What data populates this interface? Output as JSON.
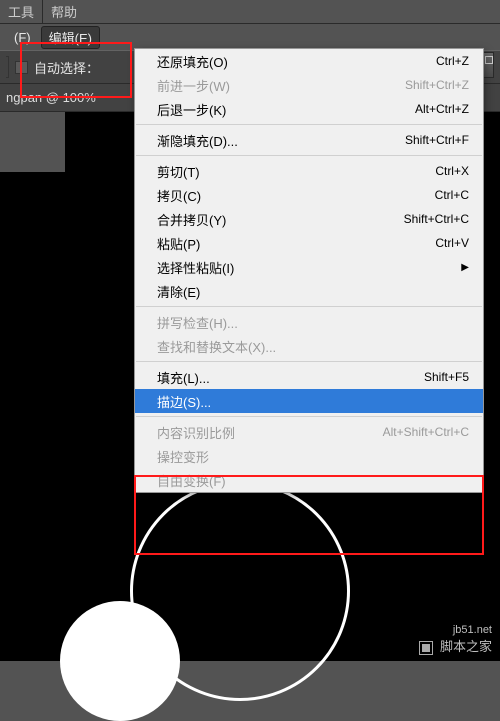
{
  "topbar": {
    "tabs": [
      "工具",
      "帮助"
    ]
  },
  "menubar": {
    "file_partial": "(F)",
    "edit": "编辑(E)"
  },
  "toolbar": {
    "bracket": true,
    "autoselect": "自动选择："
  },
  "doctab": {
    "label": "ngpan @ 100%"
  },
  "menu": {
    "g1": [
      {
        "label": "还原填充(O)",
        "sc": "Ctrl+Z"
      },
      {
        "label": "前进一步(W)",
        "sc": "Shift+Ctrl+Z",
        "disabled": true
      },
      {
        "label": "后退一步(K)",
        "sc": "Alt+Ctrl+Z"
      }
    ],
    "g2": [
      {
        "label": "渐隐填充(D)...",
        "sc": "Shift+Ctrl+F"
      }
    ],
    "g3": [
      {
        "label": "剪切(T)",
        "sc": "Ctrl+X"
      },
      {
        "label": "拷贝(C)",
        "sc": "Ctrl+C"
      },
      {
        "label": "合并拷贝(Y)",
        "sc": "Shift+Ctrl+C"
      },
      {
        "label": "粘贴(P)",
        "sc": "Ctrl+V"
      },
      {
        "label": "选择性粘贴(I)",
        "sc": "",
        "submenu": true
      },
      {
        "label": "清除(E)",
        "sc": ""
      }
    ],
    "g4": [
      {
        "label": "拼写检查(H)...",
        "sc": "",
        "disabled": true
      },
      {
        "label": "查找和替换文本(X)...",
        "sc": "",
        "disabled": true
      }
    ],
    "g5": [
      {
        "label": "填充(L)...",
        "sc": "Shift+F5"
      },
      {
        "label": "描边(S)...",
        "sc": "",
        "selected": true
      }
    ],
    "g6": [
      {
        "label": "内容识别比例",
        "sc": "Alt+Shift+Ctrl+C",
        "disabled": true
      },
      {
        "label": "操控变形",
        "sc": "",
        "disabled": true
      },
      {
        "label": "自由变换(F)",
        "sc": "",
        "disabled": true
      }
    ]
  },
  "watermark": {
    "text": "脚本之家",
    "url": "jb51.net"
  }
}
